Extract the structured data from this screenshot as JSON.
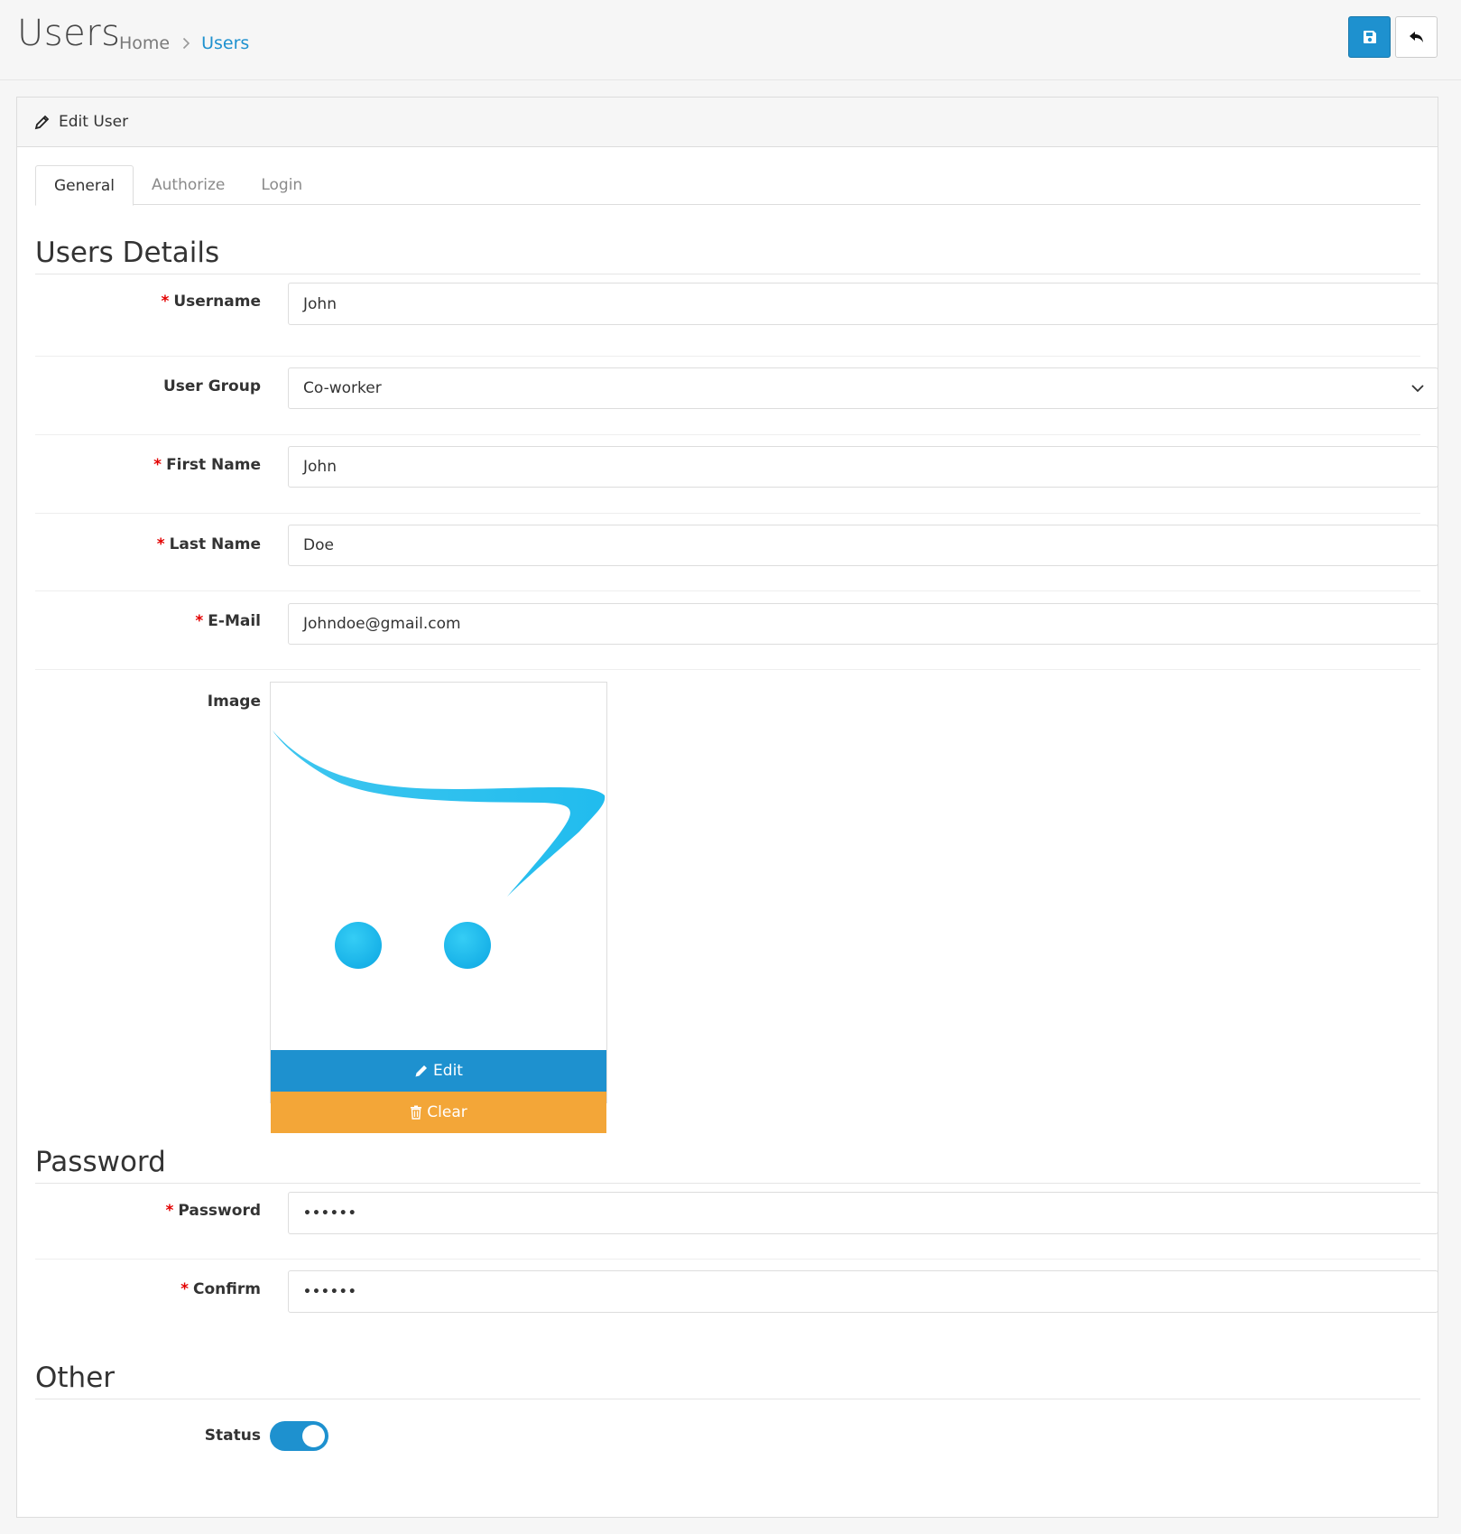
{
  "header": {
    "title": "Users",
    "breadcrumb": {
      "home": "Home",
      "current": "Users"
    },
    "buttons": {
      "save_icon": "floppy-disk-icon",
      "back_icon": "reply-arrow-icon"
    }
  },
  "card": {
    "title": "Edit User",
    "title_icon": "pencil-icon"
  },
  "tabs": [
    "General",
    "Authorize",
    "Login"
  ],
  "sections": {
    "details": "Users Details",
    "password": "Password",
    "other": "Other"
  },
  "required_mark": "*",
  "fields": {
    "username": {
      "label": "Username",
      "value": "John",
      "required": true
    },
    "user_group": {
      "label": "User Group",
      "value": "Co-worker",
      "required": false
    },
    "first_name": {
      "label": "First Name",
      "value": "John",
      "required": true
    },
    "last_name": {
      "label": "Last Name",
      "value": "Doe",
      "required": true
    },
    "email": {
      "label": "E-Mail",
      "value": "Johndoe@gmail.com",
      "required": true
    },
    "image": {
      "label": "Image",
      "edit_label": "Edit",
      "clear_label": "Clear"
    },
    "password": {
      "label": "Password",
      "value": "••••••",
      "required": true
    },
    "confirm": {
      "label": "Confirm",
      "value": "••••••",
      "required": true
    },
    "status": {
      "label": "Status",
      "enabled": true
    }
  },
  "colors": {
    "primary": "#1e91cf",
    "warning": "#f3a638",
    "required": "#e30000",
    "logo": "#21bcee"
  }
}
